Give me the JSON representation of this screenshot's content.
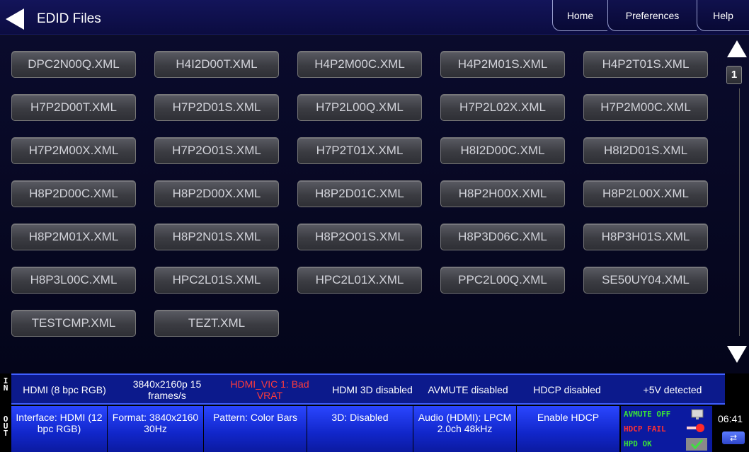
{
  "header": {
    "title": "EDID Files",
    "tabs": [
      "Home",
      "Preferences",
      "Help"
    ]
  },
  "files": [
    "DPC2N00Q.XML",
    "H4I2D00T.XML",
    "H4P2M00C.XML",
    "H4P2M01S.XML",
    "H4P2T01S.XML",
    "H7P2D00T.XML",
    "H7P2D01S.XML",
    "H7P2L00Q.XML",
    "H7P2L02X.XML",
    "H7P2M00C.XML",
    "H7P2M00X.XML",
    "H7P2O01S.XML",
    "H7P2T01X.XML",
    "H8I2D00C.XML",
    "H8I2D01S.XML",
    "H8P2D00C.XML",
    "H8P2D00X.XML",
    "H8P2D01C.XML",
    "H8P2H00X.XML",
    "H8P2L00X.XML",
    "H8P2M01X.XML",
    "H8P2N01S.XML",
    "H8P2O01S.XML",
    "H8P3D06C.XML",
    "H8P3H01S.XML",
    "H8P3L00C.XML",
    "HPC2L01S.XML",
    "HPC2L01X.XML",
    "PPC2L00Q.XML",
    "SE50UY04.XML",
    "TESTCMP.XML",
    "TEZT.XML"
  ],
  "pager": {
    "page": "1"
  },
  "status_in": {
    "label": "IN",
    "interface": "HDMI (8 bpc RGB)",
    "format": "3840x2160p 15 frames/s",
    "warning": "HDMI_VIC 1: Bad VRAT",
    "hdmi3d": "HDMI 3D disabled",
    "avmute": "AVMUTE disabled",
    "hdcp": "HDCP disabled",
    "power": "+5V detected"
  },
  "status_out": {
    "label": "OUT",
    "interface": "Interface: HDMI (12 bpc RGB)",
    "format": "Format: 3840x2160 30Hz",
    "pattern": "Pattern: Color Bars",
    "mode3d": "3D: Disabled",
    "audio": "Audio (HDMI): LPCM 2.0ch 48kHz",
    "hdcp_button": "Enable HDCP",
    "ind_avmute": "AVMUTE OFF",
    "ind_hdcp": "HDCP FAIL",
    "ind_hpd": "HPD OK",
    "clock": "06:41"
  },
  "colors": {
    "header_bg": "#0b0c40",
    "status_blue": "#1126c9",
    "warning_red": "#ff3b3b",
    "ok_green": "#39e039",
    "fail_red": "#ff3030"
  }
}
